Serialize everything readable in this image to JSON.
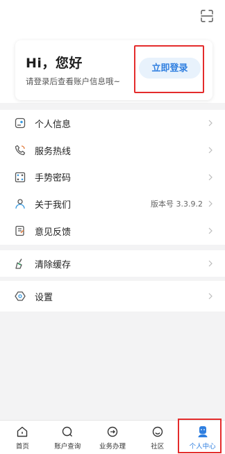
{
  "header": {
    "scan_icon": "scan-icon"
  },
  "login_card": {
    "greeting": "Hi，您好",
    "subtitle": "请登录后查看账户信息哦~",
    "login_button": "立即登录"
  },
  "menu_group_1": [
    {
      "label": "个人信息",
      "icon": "profile-icon"
    },
    {
      "label": "服务热线",
      "icon": "phone-icon"
    },
    {
      "label": "手势密码",
      "icon": "gesture-lock-icon"
    },
    {
      "label": "关于我们",
      "icon": "about-icon",
      "extra": "版本号 3.3.9.2"
    },
    {
      "label": "意见反馈",
      "icon": "feedback-icon"
    }
  ],
  "menu_group_2": [
    {
      "label": "清除缓存",
      "icon": "broom-icon"
    }
  ],
  "menu_group_3": [
    {
      "label": "设置",
      "icon": "gear-icon"
    }
  ],
  "tabbar": [
    {
      "label": "首页",
      "icon": "home-icon"
    },
    {
      "label": "账户查询",
      "icon": "search-icon"
    },
    {
      "label": "业务办理",
      "icon": "business-icon"
    },
    {
      "label": "社区",
      "icon": "community-icon"
    },
    {
      "label": "个人中心",
      "icon": "user-center-icon",
      "active": true
    }
  ],
  "colors": {
    "accent": "#2f7fe0",
    "highlight": "#e42b2b"
  }
}
